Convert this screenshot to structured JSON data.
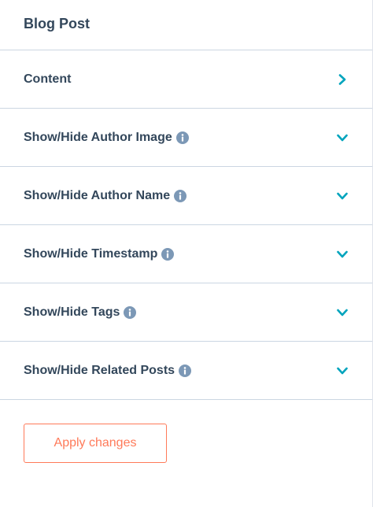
{
  "panel": {
    "title": "Blog Post"
  },
  "sections": [
    {
      "label": "Content",
      "has_info": false,
      "chevron": "chevron-right-icon"
    },
    {
      "label": "Show/Hide Author Image",
      "has_info": true,
      "chevron": "chevron-down-icon"
    },
    {
      "label": "Show/Hide Author Name",
      "has_info": true,
      "chevron": "chevron-down-icon"
    },
    {
      "label": "Show/Hide Timestamp",
      "has_info": true,
      "chevron": "chevron-down-icon"
    },
    {
      "label": "Show/Hide Tags",
      "has_info": true,
      "chevron": "chevron-down-icon"
    },
    {
      "label": "Show/Hide Related Posts",
      "has_info": true,
      "chevron": "chevron-down-icon"
    }
  ],
  "footer": {
    "apply_label": "Apply changes"
  },
  "colors": {
    "text": "#33475b",
    "accent_teal": "#00a4bd",
    "info_icon": "#7c98b6",
    "divider": "#cbd6e2",
    "button_orange": "#ff7a59"
  }
}
